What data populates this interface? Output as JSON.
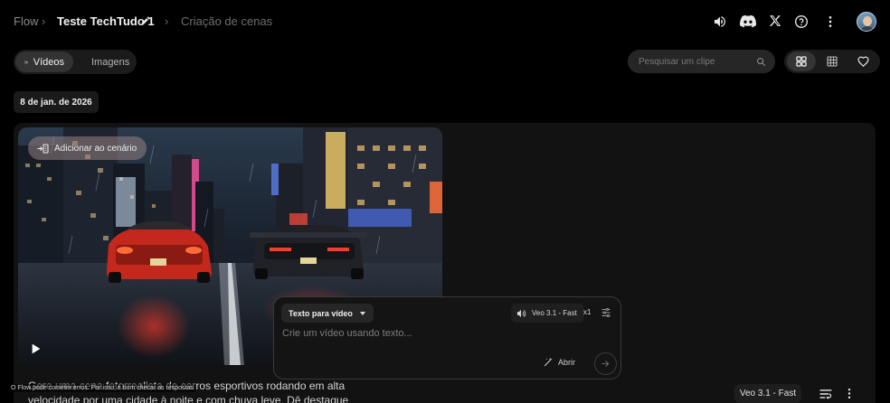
{
  "breadcrumb": {
    "root": "Flow",
    "project": "Teste TechTudo 1",
    "page": "Criação de cenas",
    "separator": "›"
  },
  "header_icons": [
    "volume-icon",
    "discord-icon",
    "x-logo-icon",
    "help-icon",
    "more-vert-icon",
    "avatar"
  ],
  "tabs": [
    {
      "label": "Vídeos",
      "icon": "video-icon",
      "selected": true
    },
    {
      "label": "Imagens",
      "icon": "image-icon",
      "selected": false
    }
  ],
  "search": {
    "placeholder": "Pesquisar um clipe"
  },
  "view_toggle": {
    "options": [
      "grid-view-icon",
      "table-view-icon",
      "favorites-icon"
    ],
    "selected": "grid-view-icon"
  },
  "date_group": "8 de jan. de 2026",
  "clip": {
    "add_to_scene": "Adicionar ao cenário",
    "prompt": "Gere uma cena fotorrealista de carros esportivos rodando em alta velocidade por uma cidade à noite e com chuva leve. Dê destaque às luzes...",
    "model": "Veo 3.1 - Fast"
  },
  "footer_note": "O Flow pode cometer erros. Por isso, é bom checar as respostas",
  "composer": {
    "mode": "Texto para vídeo",
    "model": "Veo 3.1 - Fast",
    "count": "x1",
    "placeholder": "Crie um vídeo usando texto...",
    "open_label": "Abrir"
  },
  "colors": {
    "background": "#000000",
    "surface": "#121212",
    "chip": "#262626",
    "accent_text": "#f2f2f2"
  }
}
